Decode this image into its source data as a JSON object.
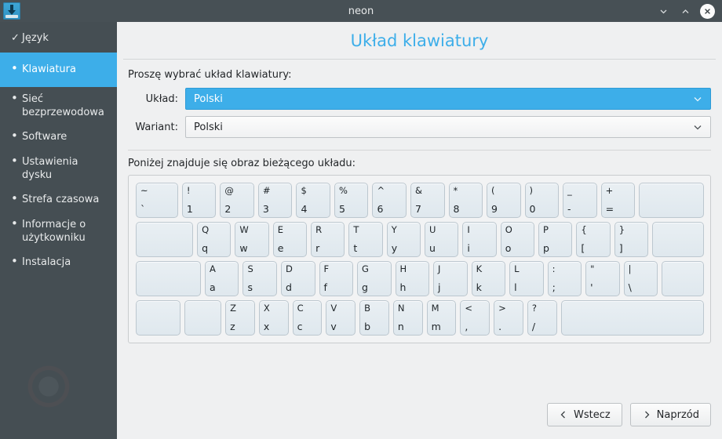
{
  "window": {
    "title": "neon",
    "app_icon": "installer-icon",
    "controls": [
      {
        "name": "minimize-button",
        "icon": "chevron-down-icon"
      },
      {
        "name": "maximize-button",
        "icon": "chevron-up-icon"
      },
      {
        "name": "close-button",
        "icon": "close-icon"
      }
    ]
  },
  "sidebar": {
    "items": [
      {
        "label": "Język",
        "mark": "✓",
        "state": "done"
      },
      {
        "label": "Klawiatura",
        "mark": "•",
        "state": "active"
      },
      {
        "label": "Sieć bezprzewodowa",
        "mark": "•",
        "state": "todo"
      },
      {
        "label": "Software",
        "mark": "•",
        "state": "todo"
      },
      {
        "label": "Ustawienia dysku",
        "mark": "•",
        "state": "todo"
      },
      {
        "label": "Strefa czasowa",
        "mark": "•",
        "state": "todo"
      },
      {
        "label": "Informacje o użytkowniku",
        "mark": "•",
        "state": "todo"
      },
      {
        "label": "Instalacja",
        "mark": "•",
        "state": "todo"
      }
    ]
  },
  "main": {
    "page_title": "Układ klawiatury",
    "intro": "Proszę wybrać układ klawiatury:",
    "layout_label": "Układ:",
    "layout_value": "Polski",
    "variant_label": "Wariant:",
    "variant_value": "Polski",
    "preview_label": "Poniżej znajduje się obraz bieżącego układu:"
  },
  "footer": {
    "back_label": "Wstecz",
    "forward_label": "Naprzód",
    "back_icon": "chevron-left-icon",
    "forward_icon": "chevron-right-icon"
  },
  "colors": {
    "accent": "#3daee9",
    "sidebar_bg": "#454e53",
    "titlebar_bg": "#475055",
    "panel_bg": "#eff0f1",
    "key_bg": "#e4ecf1"
  },
  "keyboard": {
    "rows": [
      [
        {
          "top": "~",
          "bot": "`",
          "w": "w12"
        },
        {
          "top": "!",
          "bot": "1",
          "w": ""
        },
        {
          "top": "@",
          "bot": "2",
          "w": ""
        },
        {
          "top": "#",
          "bot": "3",
          "w": ""
        },
        {
          "top": "$",
          "bot": "4",
          "w": ""
        },
        {
          "top": "%",
          "bot": "5",
          "w": ""
        },
        {
          "top": "^",
          "bot": "6",
          "w": ""
        },
        {
          "top": "&",
          "bot": "7",
          "w": ""
        },
        {
          "top": "*",
          "bot": "8",
          "w": ""
        },
        {
          "top": "(",
          "bot": "9",
          "w": ""
        },
        {
          "top": ")",
          "bot": "0",
          "w": ""
        },
        {
          "top": "_",
          "bot": "-",
          "w": ""
        },
        {
          "top": "+",
          "bot": "=",
          "w": ""
        },
        {
          "top": "",
          "bot": "",
          "w": "w19"
        }
      ],
      [
        {
          "top": "",
          "bot": "",
          "w": "w17"
        },
        {
          "top": "Q",
          "bot": "q",
          "w": ""
        },
        {
          "top": "W",
          "bot": "w",
          "w": ""
        },
        {
          "top": "E",
          "bot": "e",
          "w": ""
        },
        {
          "top": "R",
          "bot": "r",
          "w": ""
        },
        {
          "top": "T",
          "bot": "t",
          "w": ""
        },
        {
          "top": "Y",
          "bot": "y",
          "w": ""
        },
        {
          "top": "U",
          "bot": "u",
          "w": ""
        },
        {
          "top": "I",
          "bot": "i",
          "w": ""
        },
        {
          "top": "O",
          "bot": "o",
          "w": ""
        },
        {
          "top": "P",
          "bot": "p",
          "w": ""
        },
        {
          "top": "{",
          "bot": "[",
          "w": ""
        },
        {
          "top": "}",
          "bot": "]",
          "w": ""
        },
        {
          "top": "",
          "bot": "",
          "w": "w15"
        }
      ],
      [
        {
          "top": "",
          "bot": "",
          "w": "w19"
        },
        {
          "top": "A",
          "bot": "a",
          "w": ""
        },
        {
          "top": "S",
          "bot": "s",
          "w": ""
        },
        {
          "top": "D",
          "bot": "d",
          "w": ""
        },
        {
          "top": "F",
          "bot": "f",
          "w": ""
        },
        {
          "top": "G",
          "bot": "g",
          "w": ""
        },
        {
          "top": "H",
          "bot": "h",
          "w": ""
        },
        {
          "top": "J",
          "bot": "j",
          "w": ""
        },
        {
          "top": "K",
          "bot": "k",
          "w": ""
        },
        {
          "top": "L",
          "bot": "l",
          "w": ""
        },
        {
          "top": ":",
          "bot": ";",
          "w": ""
        },
        {
          "top": "\"",
          "bot": "'",
          "w": ""
        },
        {
          "top": "|",
          "bot": "\\",
          "w": ""
        },
        {
          "top": "",
          "bot": "",
          "w": "w12"
        }
      ],
      [
        {
          "top": "",
          "bot": "",
          "w": "w15"
        },
        {
          "top": "",
          "bot": "",
          "w": "w12"
        },
        {
          "top": "Z",
          "bot": "z",
          "w": ""
        },
        {
          "top": "X",
          "bot": "x",
          "w": ""
        },
        {
          "top": "C",
          "bot": "c",
          "w": ""
        },
        {
          "top": "V",
          "bot": "v",
          "w": ""
        },
        {
          "top": "B",
          "bot": "b",
          "w": ""
        },
        {
          "top": "N",
          "bot": "n",
          "w": ""
        },
        {
          "top": "M",
          "bot": "m",
          "w": ""
        },
        {
          "top": "<",
          "bot": ",",
          "w": ""
        },
        {
          "top": ">",
          "bot": ".",
          "w": ""
        },
        {
          "top": "?",
          "bot": "/",
          "w": ""
        },
        {
          "top": "",
          "bot": "",
          "w": "w50"
        }
      ]
    ]
  }
}
